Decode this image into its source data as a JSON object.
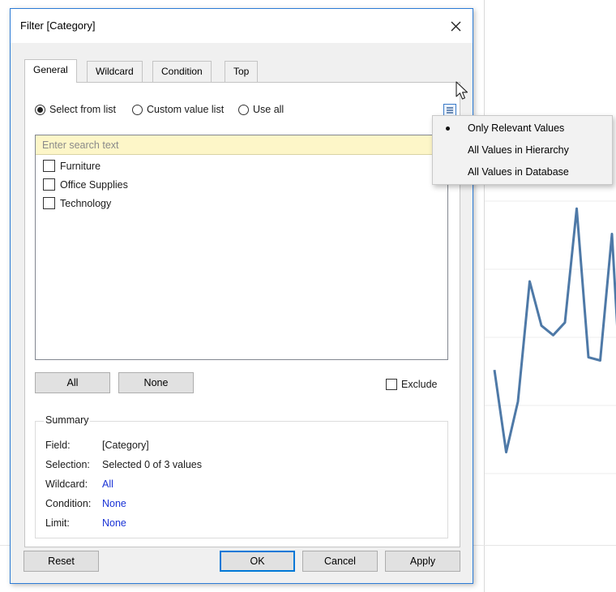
{
  "dialog": {
    "title": "Filter [Category]",
    "close_glyph": "×"
  },
  "tabs": [
    {
      "label": "General",
      "active": true
    },
    {
      "label": "Wildcard",
      "active": false
    },
    {
      "label": "Condition",
      "active": false
    },
    {
      "label": "Top",
      "active": false
    }
  ],
  "general": {
    "radios": [
      {
        "label": "Select from list",
        "selected": true
      },
      {
        "label": "Custom value list",
        "selected": false
      },
      {
        "label": "Use all",
        "selected": false
      }
    ],
    "search": {
      "placeholder": "Enter search text",
      "value": ""
    },
    "items": [
      {
        "label": "Furniture",
        "checked": false
      },
      {
        "label": "Office Supplies",
        "checked": false
      },
      {
        "label": "Technology",
        "checked": false
      }
    ],
    "buttons": {
      "all": "All",
      "none": "None"
    },
    "exclude_label": "Exclude",
    "summary": {
      "legend": "Summary",
      "rows": [
        {
          "label": "Field:",
          "value": "[Category]",
          "link": false
        },
        {
          "label": "Selection:",
          "value": "Selected 0 of 3 values",
          "link": false
        },
        {
          "label": "Wildcard:",
          "value": "All",
          "link": true
        },
        {
          "label": "Condition:",
          "value": "None",
          "link": true
        },
        {
          "label": "Limit:",
          "value": "None",
          "link": true
        }
      ]
    }
  },
  "footer": {
    "reset": "Reset",
    "ok": "OK",
    "cancel": "Cancel",
    "apply": "Apply"
  },
  "popup_menu": {
    "items": [
      {
        "label": "Only Relevant Values",
        "selected": true
      },
      {
        "label": "All Values in Hierarchy",
        "selected": false
      },
      {
        "label": "All Values in Database",
        "selected": false
      }
    ]
  },
  "background_chart": {
    "series_color": "#4e79a7",
    "values": [
      0.42,
      0.16,
      0.32,
      0.7,
      0.56,
      0.53,
      0.57,
      0.93,
      0.46,
      0.45,
      0.85,
      0.2
    ]
  }
}
